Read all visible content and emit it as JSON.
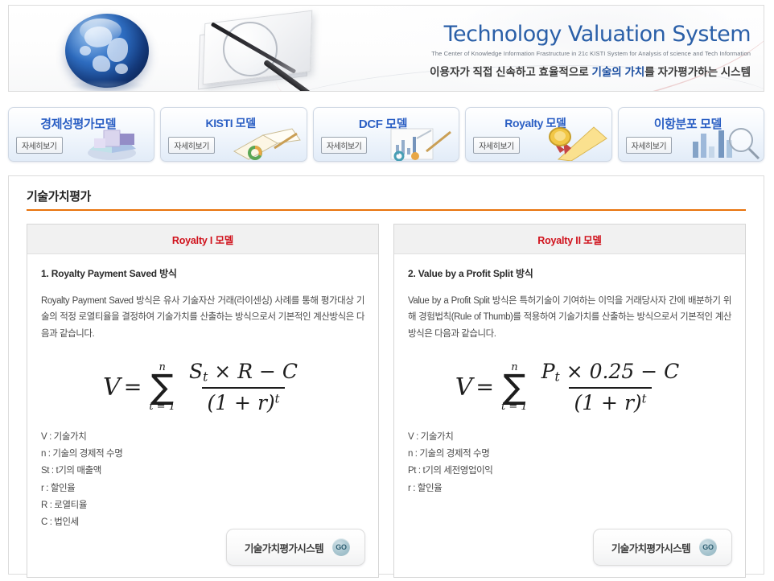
{
  "banner": {
    "title": "Technology Valuation System",
    "subtitle": "The Center of Knowledge Information Frastructure in 21c KISTI System for Analysis of science and Tech Information",
    "korean_lead": "이용자가 직접 신속하고 효율적으로",
    "korean_highlight": "기술의 가치",
    "korean_tail": "를 자가평가하는 시스템",
    "accent_color": "#2a5fa8"
  },
  "nav": {
    "more_label": "자세히보기",
    "cards": [
      {
        "title": "경제성평가모델",
        "art": "pie-chart-icon"
      },
      {
        "title": "KISTI 모델",
        "art": "open-book-icon"
      },
      {
        "title": "DCF 모델",
        "art": "bar-chart-pencil-icon"
      },
      {
        "title": "Royalty 모델",
        "art": "award-medal-icon"
      },
      {
        "title": "이항분포 모델",
        "art": "bar-chart-magnifier-icon"
      }
    ]
  },
  "section": {
    "title": "기술가치평가",
    "underline_color": "#e8730c"
  },
  "panels": [
    {
      "header": "Royalty I 모델",
      "header_color": "#d0111b",
      "method_title": "1. Royalty Payment Saved 방식",
      "description": "Royalty Payment Saved 방식은 유사 기술자산 거래(라이센싱) 사례를 통해 평가대상 기술의 적정 로열티율을 결정하여 기술가치를 산출하는 방식으로서 기본적인 계산방식은 다음과 같습니다.",
      "formula": {
        "lhs": "V",
        "eq": "=",
        "sum_top": "n",
        "sum_symbol": "∑",
        "sum_bottom": "t = 1",
        "numerator_main": "S",
        "numerator_sub": "t",
        "numerator_rest": "× R − C",
        "denominator": "(1 + r)",
        "denominator_sup": "t"
      },
      "legend": [
        "V : 기술가치",
        "n : 기술의 경제적 수명",
        "St : t기의 매출액",
        "r : 할인율",
        "R : 로열티율",
        "C : 법인세"
      ],
      "go_button": {
        "label": "기술가치평가시스템",
        "badge": "GO"
      }
    },
    {
      "header": "Royalty II 모델",
      "header_color": "#d0111b",
      "method_title": "2. Value by a Profit Split 방식",
      "description": "Value by a Profit Split 방식은 특허기술이 기여하는 이익을 거래당사자 간에 배분하기 위해 경험법칙(Rule of Thumb)를 적용하여 기술가치를 산출하는 방식으로서 기본적인 계산방식은 다음과 같습니다.",
      "formula": {
        "lhs": "V",
        "eq": "=",
        "sum_top": "n",
        "sum_symbol": "∑",
        "sum_bottom": "t = 1",
        "numerator_main": "P",
        "numerator_sub": "t",
        "numerator_rest": "× 0.25 − C",
        "denominator": "(1 + r)",
        "denominator_sup": "t"
      },
      "legend": [
        "V : 기술가치",
        "n : 기술의 경제적 수명",
        "Pt : t기의 세전영업이익",
        "r : 할인율"
      ],
      "go_button": {
        "label": "기술가치평가시스템",
        "badge": "GO"
      }
    }
  ]
}
